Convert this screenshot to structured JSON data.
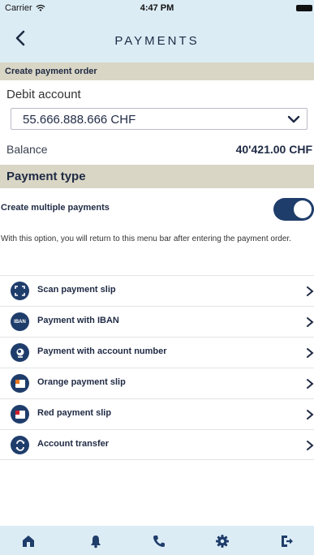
{
  "status_bar": {
    "carrier": "Carrier",
    "time": "4:47 PM"
  },
  "nav": {
    "title": "PAYMENTS",
    "back_icon": "chevron-left-icon"
  },
  "create_section": {
    "header": "Create payment order",
    "debit_label": "Debit account",
    "debit_value": "55.666.888.666 CHF",
    "balance_label": "Balance",
    "balance_value": "40'421.00 CHF"
  },
  "payment_type": {
    "header": "Payment type",
    "multi_label": "Create multiple payments",
    "multi_enabled": true,
    "multi_note": "With this option, you will return to this menu bar after entering the payment order.",
    "options": [
      {
        "label": "Scan payment slip",
        "icon": "scan-icon"
      },
      {
        "label": "Payment with IBAN",
        "icon": "iban-icon",
        "icon_text": "IBAN"
      },
      {
        "label": "Payment with account number",
        "icon": "globe-icon"
      },
      {
        "label": "Orange payment slip",
        "icon": "orange-slip-icon"
      },
      {
        "label": "Red payment slip",
        "icon": "red-slip-icon"
      },
      {
        "label": "Account transfer",
        "icon": "transfer-icon"
      }
    ]
  },
  "tabbar": {
    "items": [
      "home-icon",
      "bell-icon",
      "phone-icon",
      "gear-icon",
      "logout-icon"
    ]
  },
  "colors": {
    "header_bg": "#dcecf5",
    "section_bg": "#d9d6c5",
    "accent": "#1f3d6b",
    "slip_orange": "#e87722",
    "slip_red": "#d0212d"
  }
}
